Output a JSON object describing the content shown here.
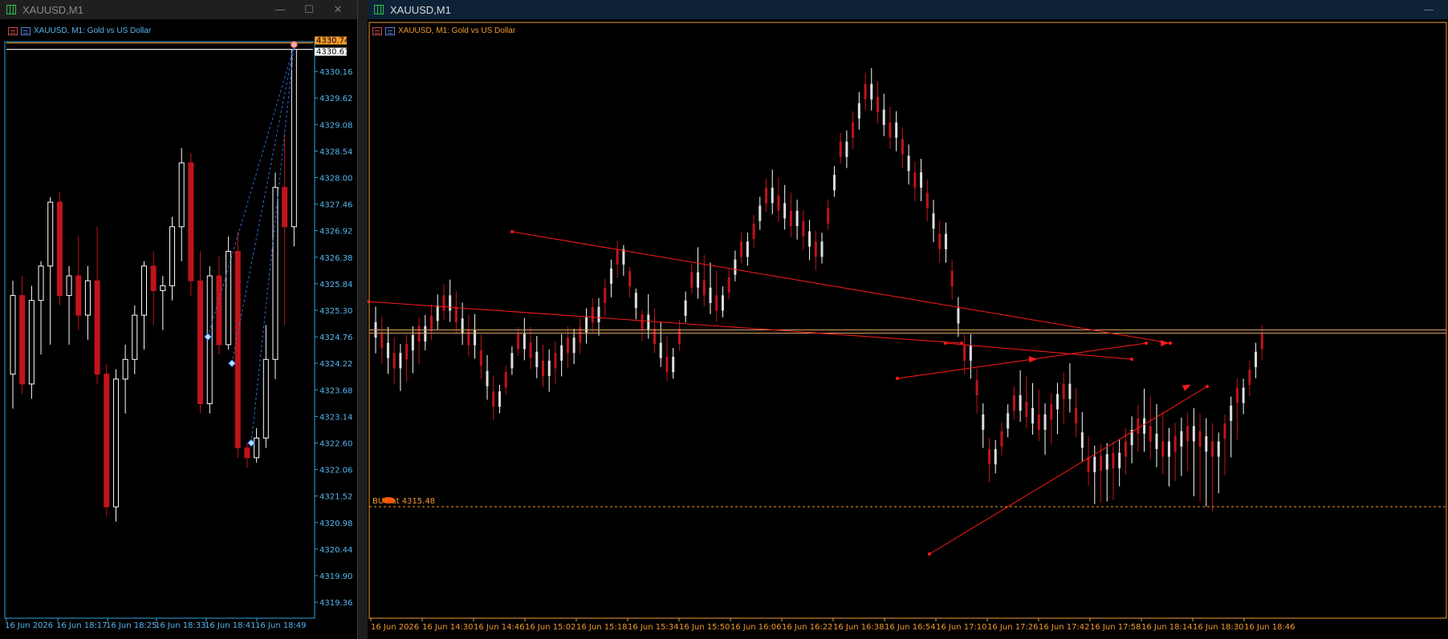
{
  "left_window": {
    "title": "XAUUSD,M1",
    "header": "XAUUSD, M1:  Gold vs US Dollar",
    "controls": {
      "minimize": "—",
      "maximize": "☐",
      "close": "✕"
    },
    "price_tags": [
      "4330.74",
      "4330.61"
    ],
    "price_axis": [
      "4330.16",
      "4329.62",
      "4329.08",
      "4328.54",
      "4328.00",
      "4327.46",
      "4326.92",
      "4326.38",
      "4325.84",
      "4325.30",
      "4324.76",
      "4324.22",
      "4323.68",
      "4323.14",
      "4322.60",
      "4322.06",
      "4321.52",
      "4320.98",
      "4320.44",
      "4319.90",
      "4319.36"
    ],
    "time_axis": [
      "16 Jun 2026",
      "16 Jun 18:17",
      "16 Jun 18:25",
      "16 Jun 18:33",
      "16 Jun 18:41",
      "16 Jun 18:49"
    ],
    "colors": {
      "frame": "#2fa3e0",
      "axis_text": "#56b7f0",
      "bull": "#ffffff",
      "bear": "#c0141a",
      "tag_ask": "#f29a2e",
      "tag_bid": "#ffffff"
    }
  },
  "right_window": {
    "title": "XAUUSD,M1",
    "header": "XAUUSD, M1:  Gold vs US Dollar",
    "controls": {
      "minimize": "—"
    },
    "order_label": "BUY   at 4315.48",
    "time_axis": [
      "16 Jun 2026",
      "16 Jun 14:30",
      "16 Jun 14:46",
      "16 Jun 15:02",
      "16 Jun 15:18",
      "16 Jun 15:34",
      "16 Jun 15:50",
      "16 Jun 16:06",
      "16 Jun 16:22",
      "16 Jun 16:38",
      "16 Jun 16:54",
      "16 Jun 17:10",
      "16 Jun 17:26",
      "16 Jun 17:42",
      "16 Jun 17:58",
      "16 Jun 18:14",
      "16 Jun 18:30",
      "16 Jun 18:46"
    ],
    "colors": {
      "frame": "#f29a2e",
      "axis_text": "#f29a2e",
      "bull": "#ffffff",
      "bear": "#c0141a",
      "trendline": "#ff1a1a",
      "order": "#f29a2e"
    }
  },
  "chart_data": [
    {
      "type": "candlestick",
      "symbol": "XAUUSD",
      "timeframe": "M1",
      "series": [
        {
          "values": [
            [
              4324.0,
              4325.9,
              4323.3,
              4325.6
            ],
            [
              4325.6,
              4326.0,
              4323.6,
              4323.8
            ],
            [
              4323.8,
              4325.8,
              4323.5,
              4325.5
            ],
            [
              4325.5,
              4326.3,
              4324.4,
              4326.2
            ],
            [
              4326.2,
              4327.6,
              4324.6,
              4327.5
            ],
            [
              4327.5,
              4327.7,
              4325.4,
              4325.6
            ],
            [
              4325.6,
              4326.2,
              4324.6,
              4326.0
            ],
            [
              4326.0,
              4326.8,
              4324.9,
              4325.2
            ],
            [
              4325.2,
              4326.2,
              4324.7,
              4325.9
            ],
            [
              4325.9,
              4327.0,
              4323.8,
              4324.0
            ],
            [
              4324.0,
              4324.2,
              4321.1,
              4321.3
            ],
            [
              4321.3,
              4324.1,
              4321.0,
              4323.9
            ],
            [
              4323.9,
              4324.6,
              4323.2,
              4324.3
            ],
            [
              4324.3,
              4325.4,
              4324.0,
              4325.2
            ],
            [
              4325.2,
              4326.3,
              4324.5,
              4326.2
            ],
            [
              4326.2,
              4326.5,
              4325.0,
              4325.7
            ],
            [
              4325.7,
              4326.0,
              4324.9,
              4325.8
            ],
            [
              4325.8,
              4327.2,
              4325.5,
              4327.0
            ],
            [
              4327.0,
              4328.6,
              4326.3,
              4328.3
            ],
            [
              4328.3,
              4328.5,
              4325.6,
              4325.9
            ],
            [
              4325.9,
              4326.5,
              4323.2,
              4323.4
            ],
            [
              4323.4,
              4326.2,
              4323.2,
              4326.0
            ],
            [
              4326.0,
              4326.4,
              4324.4,
              4324.6
            ],
            [
              4324.6,
              4326.8,
              4324.5,
              4326.5
            ],
            [
              4326.5,
              4326.9,
              4322.3,
              4322.5
            ],
            [
              4322.5,
              4322.6,
              4322.1,
              4322.3
            ],
            [
              4322.3,
              4322.9,
              4322.2,
              4322.7
            ],
            [
              4322.7,
              4325.0,
              4322.5,
              4324.3
            ],
            [
              4324.3,
              4328.1,
              4323.9,
              4327.8
            ],
            [
              4327.8,
              4328.9,
              4325.0,
              4327.0
            ],
            [
              4327.0,
              4330.7,
              4326.6,
              4330.61
            ]
          ]
        }
      ],
      "markers": [
        4330.74,
        4330.61
      ]
    },
    {
      "type": "candlestick",
      "symbol": "XAUUSD",
      "timeframe": "M1",
      "series": [
        {
          "values": [
            [
              4322.0,
              4322.6,
              4320.6,
              4321.2
            ],
            [
              4321.2,
              4322.2,
              4320.3,
              4321.9
            ],
            [
              4321.9,
              4323.1,
              4321.6,
              4322.7
            ],
            [
              4322.7,
              4323.3,
              4321.4,
              4321.8
            ],
            [
              4321.8,
              4322.4,
              4319.7,
              4320.2
            ],
            [
              4320.2,
              4321.9,
              4320.0,
              4321.7
            ],
            [
              4321.7,
              4322.3,
              4320.6,
              4321.0
            ],
            [
              4321.0,
              4322.0,
              4320.4,
              4321.6
            ],
            [
              4321.6,
              4322.7,
              4321.2,
              4322.4
            ],
            [
              4322.4,
              4324.2,
              4321.9,
              4323.9
            ],
            [
              4323.9,
              4324.0,
              4321.8,
              4322.2
            ],
            [
              4322.2,
              4323.0,
              4320.8,
              4321.1
            ],
            [
              4321.1,
              4323.6,
              4320.9,
              4323.3
            ],
            [
              4323.3,
              4324.3,
              4322.3,
              4322.7
            ],
            [
              4322.7,
              4324.4,
              4322.5,
              4324.1
            ],
            [
              4324.1,
              4325.8,
              4323.8,
              4325.5
            ],
            [
              4325.5,
              4326.2,
              4324.5,
              4324.9
            ],
            [
              4324.9,
              4325.3,
              4323.6,
              4324.1
            ],
            [
              4324.1,
              4327.0,
              4323.9,
              4326.7
            ],
            [
              4326.7,
              4328.6,
              4326.3,
              4328.2
            ],
            [
              4328.2,
              4328.8,
              4326.8,
              4327.2
            ],
            [
              4327.2,
              4327.6,
              4325.4,
              4325.9
            ],
            [
              4325.9,
              4326.4,
              4323.8,
              4324.3
            ],
            [
              4324.3,
              4324.7,
              4320.9,
              4321.4
            ],
            [
              4321.4,
              4321.8,
              4318.0,
              4318.7
            ],
            [
              4318.7,
              4320.4,
              4318.4,
              4320.1
            ],
            [
              4320.1,
              4321.1,
              4319.2,
              4319.6
            ],
            [
              4319.6,
              4320.8,
              4318.6,
              4320.4
            ],
            [
              4320.4,
              4321.2,
              4318.0,
              4318.5
            ],
            [
              4318.5,
              4319.0,
              4317.2,
              4318.6
            ],
            [
              4318.6,
              4320.0,
              4317.9,
              4319.5
            ],
            [
              4319.5,
              4320.7,
              4318.2,
              4318.9
            ],
            [
              4318.9,
              4319.8,
              4317.7,
              4319.3
            ],
            [
              4319.3,
              4320.0,
              4316.6,
              4318.9
            ],
            [
              4318.9,
              4320.6,
              4317.4,
              4320.3
            ],
            [
              4320.3,
              4322.0,
              4319.9,
              4321.7
            ]
          ]
        }
      ],
      "order_price": 4315.48
    }
  ]
}
